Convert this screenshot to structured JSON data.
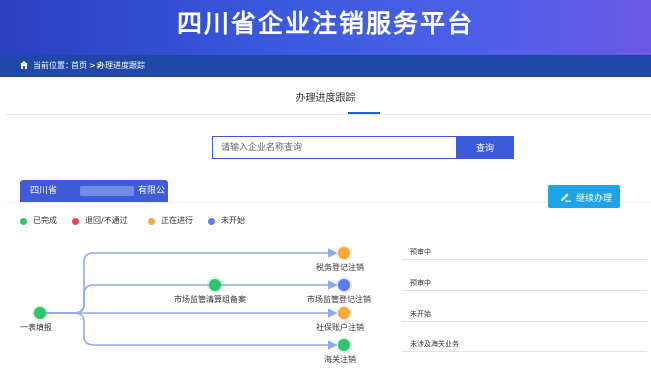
{
  "header": {
    "title": "四川省企业注销服务平台"
  },
  "breadcrumb": {
    "label": "当前位置：",
    "home": "首页",
    "separator": ">>",
    "current": "办理进度跟踪"
  },
  "page": {
    "heading": "办理进度跟踪"
  },
  "search": {
    "placeholder": "请输入企业名称查询",
    "button_label": "查询"
  },
  "company": {
    "name_prefix": "四川省",
    "name_suffix": "有限公司"
  },
  "actions": {
    "continue_label": "继续办理"
  },
  "legend": [
    {
      "label": "已完成",
      "color": "#2ec56b"
    },
    {
      "label": "退回/不通过",
      "color": "#f2415a"
    },
    {
      "label": "正在进行",
      "color": "#f7a93b"
    },
    {
      "label": "未开始",
      "color": "#5b7cf0"
    }
  ],
  "flow": {
    "start": {
      "label": "一表填报",
      "status": "completed"
    },
    "intermediate": {
      "label": "市场监管清算组备案",
      "status": "completed"
    },
    "steps": [
      {
        "label": "税务登记注销",
        "status": "in-progress",
        "status_text": "预审中"
      },
      {
        "label": "市场监管登记注销",
        "status": "not-started",
        "status_text": "预审中"
      },
      {
        "label": "社保账户注销",
        "status": "in-progress",
        "status_text": "未开始"
      },
      {
        "label": "海关注销",
        "status": "completed",
        "status_text": "未涉及海关业务"
      }
    ]
  },
  "colors": {
    "banner": "#3b5ae0",
    "breadcrumb_bar": "#1e47a6",
    "accent": "#3b5bdb",
    "continue_button": "#1fa3e8",
    "flow_line": "#8fa9ee"
  }
}
